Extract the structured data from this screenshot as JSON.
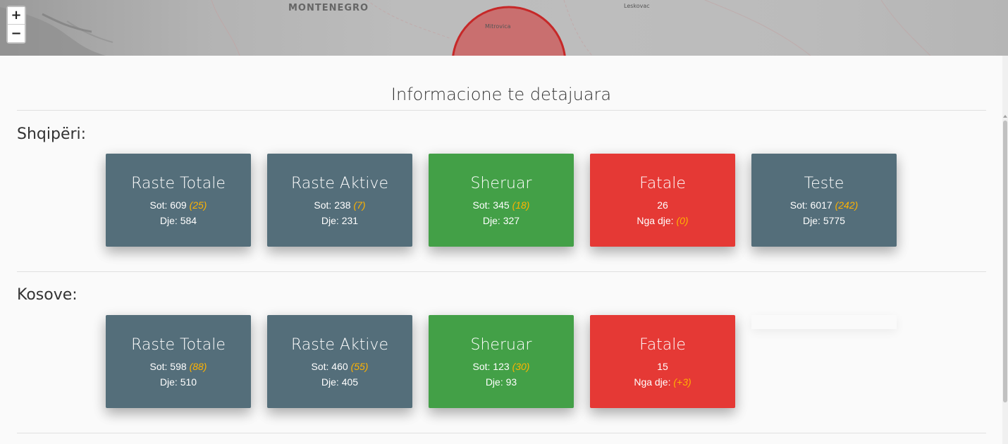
{
  "map": {
    "labels": {
      "country": "MONTENEGRO",
      "city_mitrovica": "Mitrovica",
      "city_leskovac": "Leskovac"
    },
    "zoom_in": "+",
    "zoom_out": "−",
    "marker_color": "#d32f2f"
  },
  "section_title": "Informacione te detajuara",
  "countries": [
    {
      "name": "Shqipëri:",
      "cards": [
        {
          "title": "Raste Totale",
          "l1_label": "Sot: 609",
          "l1_delta": "(25)",
          "l2_label": "Dje: 584",
          "l2_delta": ""
        },
        {
          "title": "Raste Aktive",
          "l1_label": "Sot: 238",
          "l1_delta": "(7)",
          "l2_label": "Dje: 231",
          "l2_delta": ""
        },
        {
          "title": "Sheruar",
          "l1_label": "Sot: 345",
          "l1_delta": "(18)",
          "l2_label": "Dje: 327",
          "l2_delta": ""
        },
        {
          "title": "Fatale",
          "l1_label": "26",
          "l1_delta": "",
          "l2_label": "Nga dje:",
          "l2_delta": "(0)"
        },
        {
          "title": "Teste",
          "l1_label": "Sot: 6017",
          "l1_delta": "(242)",
          "l2_label": "Dje: 5775",
          "l2_delta": ""
        }
      ]
    },
    {
      "name": "Kosove:",
      "cards": [
        {
          "title": "Raste Totale",
          "l1_label": "Sot: 598",
          "l1_delta": "(88)",
          "l2_label": "Dje: 510",
          "l2_delta": ""
        },
        {
          "title": "Raste Aktive",
          "l1_label": "Sot: 460",
          "l1_delta": "(55)",
          "l2_label": "Dje: 405",
          "l2_delta": ""
        },
        {
          "title": "Sheruar",
          "l1_label": "Sot: 123",
          "l1_delta": "(30)",
          "l2_label": "Dje: 93",
          "l2_delta": ""
        },
        {
          "title": "Fatale",
          "l1_label": "15",
          "l1_delta": "",
          "l2_label": "Nga dje:",
          "l2_delta": "(+3)"
        }
      ]
    }
  ],
  "colors": {
    "gray": "#546e7a",
    "green": "#43a047",
    "red": "#e53935",
    "delta": "#ffb300"
  }
}
